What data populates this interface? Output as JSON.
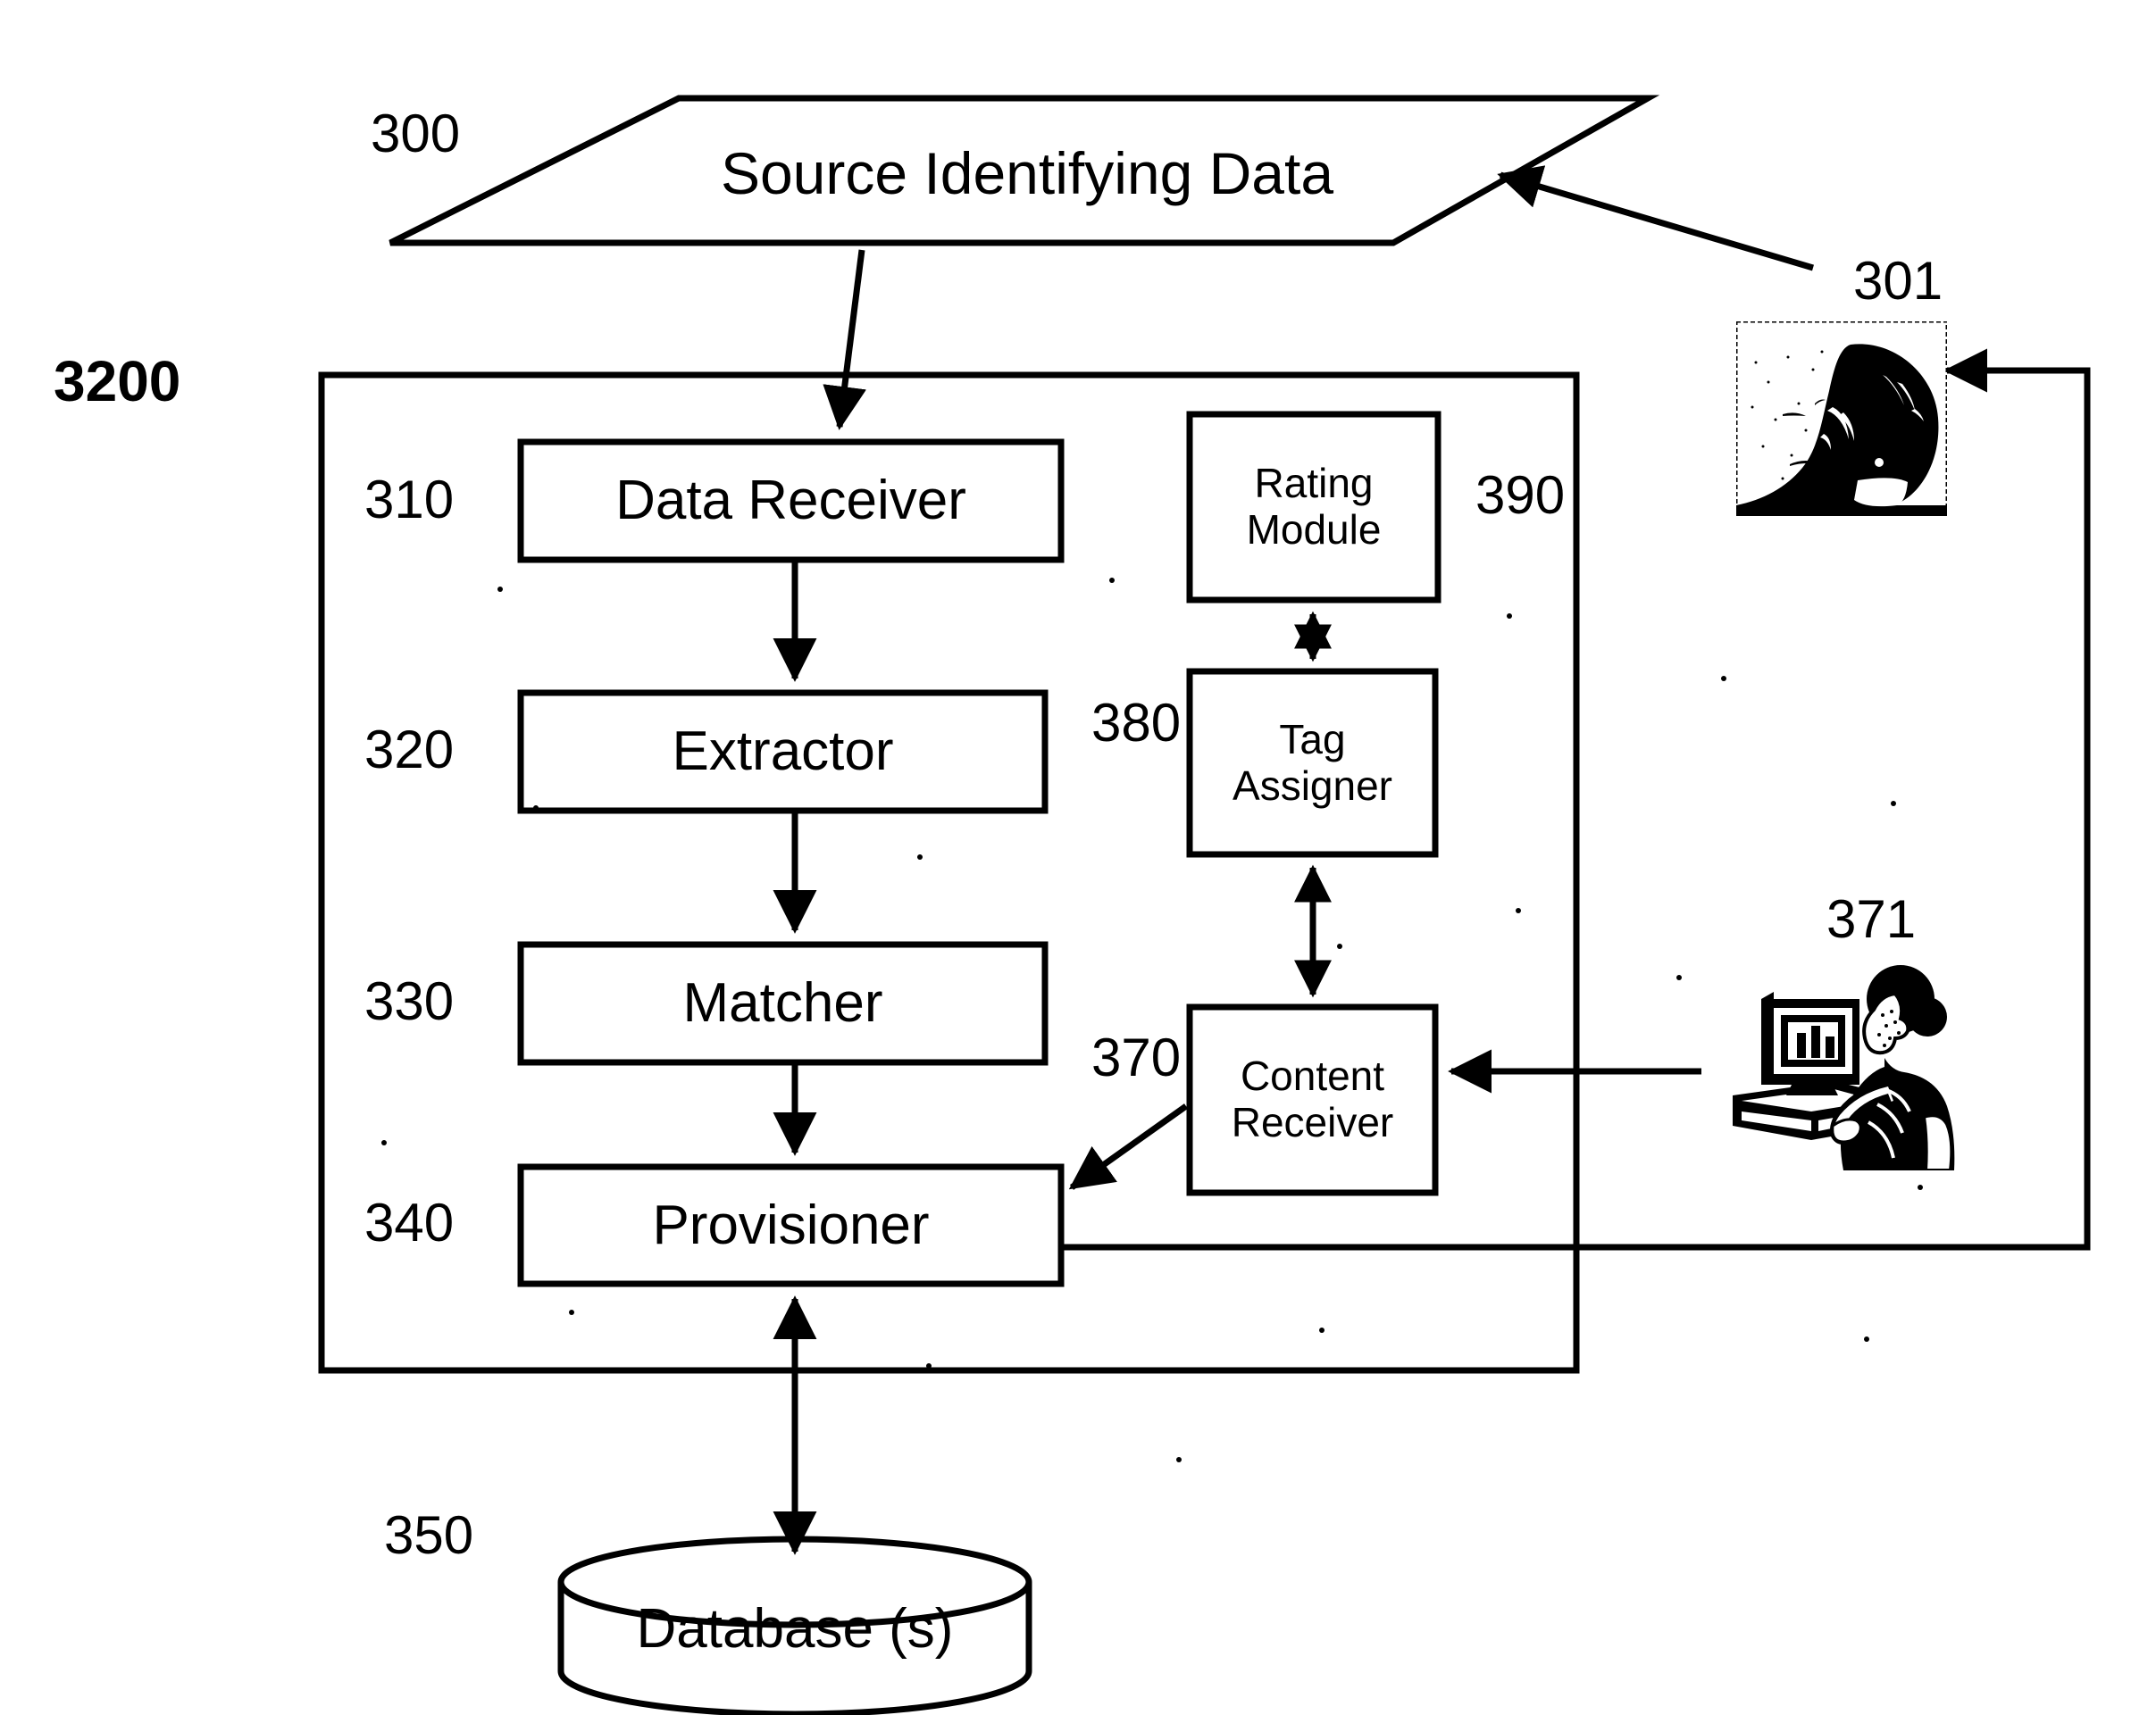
{
  "figure": {
    "system_label": "3200",
    "input_shape": {
      "ref": "300",
      "label": "Source Identifying Data"
    },
    "pipeline": [
      {
        "ref": "310",
        "label": "Data Receiver"
      },
      {
        "ref": "320",
        "label": "Extractor"
      },
      {
        "ref": "330",
        "label": "Matcher"
      },
      {
        "ref": "340",
        "label": "Provisioner"
      }
    ],
    "side_modules": [
      {
        "ref": "390",
        "label": "Rating Module",
        "line1": "Rating",
        "line2": "Module"
      },
      {
        "ref": "380",
        "label": "Tag Assigner",
        "line1": "Tag",
        "line2": "Assigner"
      },
      {
        "ref": "370",
        "label": "Content Receiver",
        "line1": "Content",
        "line2": "Receiver"
      }
    ],
    "datastore": {
      "ref": "350",
      "label": "Database (s)"
    },
    "actors": [
      {
        "ref": "301",
        "name": "person-photo"
      },
      {
        "ref": "371",
        "name": "user-at-computer-clipart"
      }
    ],
    "colors": {
      "stroke": "#000000",
      "background": "#ffffff"
    }
  }
}
